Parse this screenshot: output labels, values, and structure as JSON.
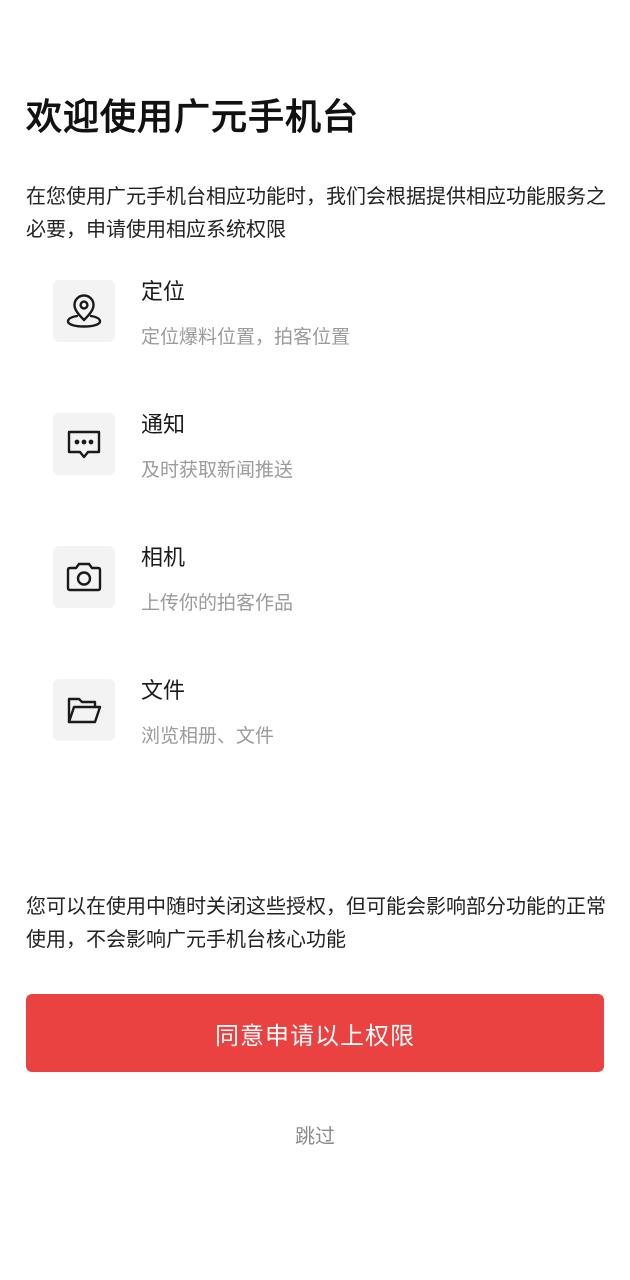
{
  "header": {
    "title": "欢迎使用广元手机台"
  },
  "intro": {
    "text": "在您使用广元手机台相应功能时，我们会根据提供相应功能服务之必要，申请使用相应系统权限"
  },
  "permissions": [
    {
      "icon": "location-pin-icon",
      "name": "定位",
      "description": "定位爆料位置，拍客位置"
    },
    {
      "icon": "message-bubble-icon",
      "name": "通知",
      "description": "及时获取新闻推送"
    },
    {
      "icon": "camera-icon",
      "name": "相机",
      "description": "上传你的拍客作品"
    },
    {
      "icon": "folder-icon",
      "name": "文件",
      "description": "浏览相册、文件"
    }
  ],
  "footer": {
    "note": "您可以在使用中随时关闭这些授权，但可能会影响部分功能的正常使用，不会影响广元手机台核心功能",
    "agree_label": "同意申请以上权限",
    "skip_label": "跳过"
  },
  "colors": {
    "accent": "#ea4141",
    "icon_bg": "#f3f3f3",
    "secondary_text": "#9b9b9b"
  }
}
